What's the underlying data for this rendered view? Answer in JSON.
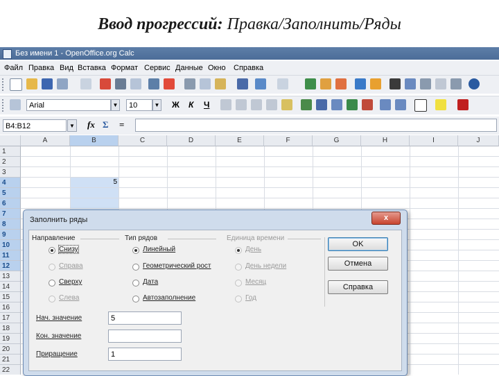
{
  "slide": {
    "title_bold": "Ввод прогрессий:",
    "title_rest": " Правка/Заполнить/Ряды"
  },
  "app": {
    "window_title": "Без имени 1 - OpenOffice.org Calc",
    "menu": [
      "Файл",
      "Правка",
      "Вид",
      "Вставка",
      "Формат",
      "Сервис",
      "Данные",
      "Окно",
      "Справка"
    ],
    "font_name": "Arial",
    "font_size": "10",
    "fmt_bold": "Ж",
    "fmt_italic": "К",
    "fmt_underline": "Ч",
    "name_box": "B4:B12",
    "fx_label": "fx",
    "sum_label": "Σ",
    "eq_label": "="
  },
  "sheet": {
    "columns": [
      "A",
      "B",
      "C",
      "D",
      "E",
      "F",
      "G",
      "H",
      "I",
      "J"
    ],
    "rows": [
      "1",
      "2",
      "3",
      "4",
      "5",
      "6",
      "7",
      "8",
      "9",
      "10",
      "11",
      "12",
      "13",
      "14",
      "15",
      "16",
      "17",
      "18",
      "19",
      "20",
      "21",
      "22"
    ],
    "b4_value": "5"
  },
  "dialog": {
    "title": "Заполнить ряды",
    "close": "x",
    "direction": {
      "label": "Направление",
      "options": [
        "Снизу",
        "Справа",
        "Сверху",
        "Слева"
      ]
    },
    "series_type": {
      "label": "Тип рядов",
      "options": [
        "Линейный",
        "Геометрический рост",
        "Дата",
        "Автозаполнение"
      ]
    },
    "time_unit": {
      "label": "Единица времени",
      "options": [
        "День",
        "День недели",
        "Месяц",
        "Год"
      ]
    },
    "start_label": "Нач. значение",
    "start_value": "5",
    "end_label": "Кон. значение",
    "end_value": "",
    "increment_label": "Приращение",
    "increment_value": "1",
    "ok": "OK",
    "cancel": "Отмена",
    "help": "Справка"
  }
}
